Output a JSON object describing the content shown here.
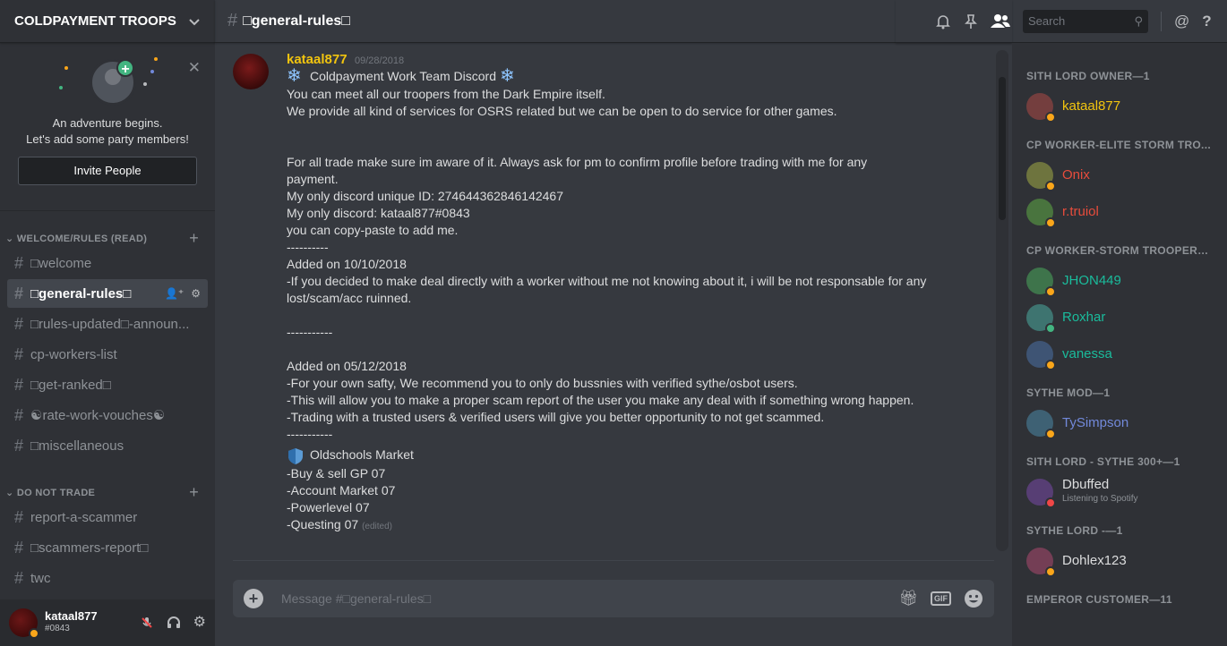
{
  "guild": {
    "name": "COLDPAYMENT TROOPS",
    "chevron_icon": "chevron-down-icon"
  },
  "welcome": {
    "line1": "An adventure begins.",
    "line2": "Let's add some party members!",
    "invite_label": "Invite People",
    "close": "✕"
  },
  "categories": [
    {
      "name": "WELCOME/RULES (READ)",
      "channels": [
        "□welcome",
        "□general-rules□",
        "□rules-updated□-announ...",
        "cp-workers-list",
        "□get-ranked□",
        "☯rate-work-vouches☯",
        "□miscellaneous"
      ]
    },
    {
      "name": "DO NOT TRADE",
      "channels": [
        "report-a-scammer",
        "□scammers-report□",
        "twc"
      ]
    }
  ],
  "user": {
    "name": "kataal877",
    "discriminator": "#0843"
  },
  "channel": {
    "title": "□general-rules□"
  },
  "search": {
    "placeholder": "Search"
  },
  "message": {
    "author": "kataal877",
    "timestamp": "09/28/2018",
    "lines": [
      "Coldpayment Work Team Discord",
      "You can meet all our troopers from the Dark Empire itself.",
      "We provide all kind of services for OSRS related but we can be open to do service for other games.",
      "",
      "",
      "For all trade make sure im aware of it.        Always ask for pm to confirm profile before trading with me for any",
      "payment.",
      "My only discord unique ID: 274644362846142467",
      "My only discord: kataal877#0843",
      "you can copy-paste to add me.",
      "----------",
      "Added on 10/10/2018",
      "-If you decided to make deal directly with a worker without me not knowing about it, i will be not responsable for any",
      "lost/scam/acc ruinned.",
      "",
      "-----------",
      "",
      "Added on 05/12/2018",
      "-For your own safty, We recommend you to only do bussnies with verified sythe/osbot users.",
      "-This will allow you to make a proper scam report of the user you make any deal with if something wrong happen.",
      "-Trading with a trusted users & verified users will give you better opportunity to not get scammed.",
      "-----------",
      "Oldschools Market",
      "-Buy & sell GP 07",
      "-Account Market 07",
      "-Powerlevel 07",
      "-Questing 07"
    ],
    "edited": "(edited)"
  },
  "composer": {
    "placeholder": "Message #□general-rules□",
    "gif": "GIF"
  },
  "members": [
    {
      "role": "SITH LORD OWNER—1",
      "users": [
        {
          "name": "kataal877",
          "color": "#f1c40f",
          "status": "#faa61a"
        }
      ]
    },
    {
      "role": "CP WORKER-ELITE STORM TRO...",
      "users": [
        {
          "name": "Onix",
          "color": "#e74c3c",
          "status": "#faa61a"
        },
        {
          "name": "r.truiol",
          "color": "#e74c3c",
          "status": "#faa61a"
        }
      ]
    },
    {
      "role": "CP WORKER-STORM TROOPERS...",
      "users": [
        {
          "name": "JHON449",
          "color": "#1abc9c",
          "status": "#faa61a"
        },
        {
          "name": "Roxhar",
          "color": "#1abc9c",
          "status": "#43b581"
        },
        {
          "name": "vanessa",
          "color": "#1abc9c",
          "status": "#faa61a"
        }
      ]
    },
    {
      "role": "SYTHE MOD—1",
      "users": [
        {
          "name": "TySimpson",
          "color": "#7289da",
          "status": "#faa61a"
        }
      ]
    },
    {
      "role": "SITH LORD - SYTHE 300+—1",
      "users": [
        {
          "name": "Dbuffed",
          "color": "#dcddde",
          "status": "#f04747",
          "activity": "Listening to Spotify"
        }
      ]
    },
    {
      "role": "SYTHE LORD -—1",
      "users": [
        {
          "name": "Dohlex123",
          "color": "#dcddde",
          "status": "#faa61a"
        }
      ]
    },
    {
      "role": "EMPEROR CUSTOMER—11",
      "users": []
    }
  ]
}
